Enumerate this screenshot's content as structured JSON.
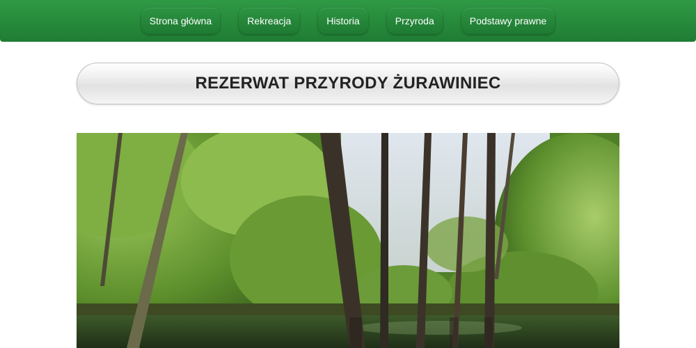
{
  "nav": {
    "items": [
      {
        "label": "Strona główna"
      },
      {
        "label": "Rekreacja"
      },
      {
        "label": "Historia"
      },
      {
        "label": "Przyroda"
      },
      {
        "label": "Podstawy prawne"
      }
    ]
  },
  "header": {
    "title": "REZERWAT PRZYRODY ŻURAWINIEC"
  },
  "colors": {
    "nav_green": "#23863a",
    "title_text": "#222222"
  }
}
